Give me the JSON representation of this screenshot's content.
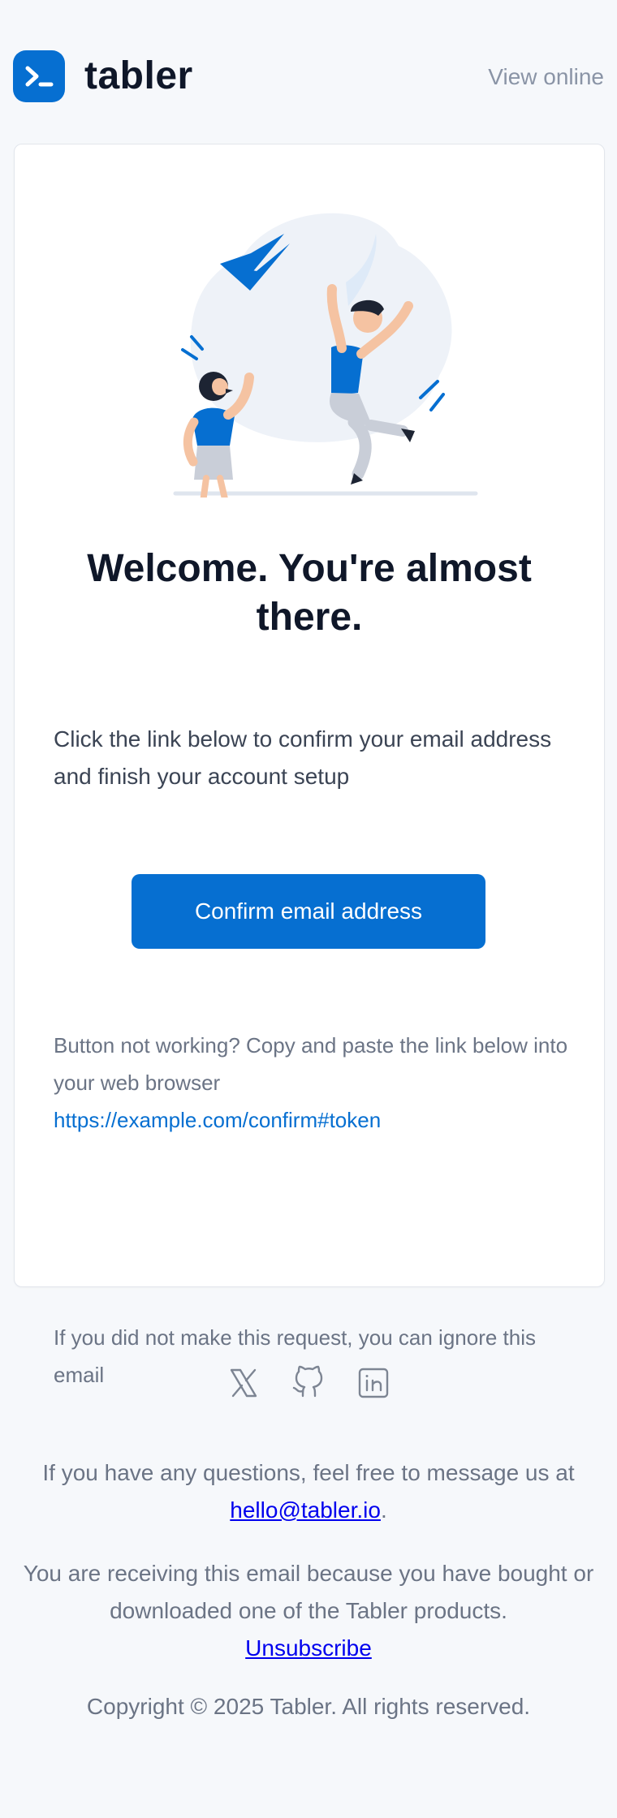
{
  "header": {
    "brand_name": "tabler",
    "view_online": "View online",
    "logo_icon": "terminal-prompt-icon"
  },
  "card": {
    "illustration_icon": "celebrating-people-illustration",
    "title": "Welcome. You're almost there.",
    "intro": "Click the link below to confirm your email address and finish your account setup",
    "confirm_button": "Confirm email address",
    "fallback_text": "Button not working? Copy and paste the link below into your web browser",
    "fallback_link": "https://example.com/confirm#token",
    "ignore_text": "If you did not make this request, you can ignore this email"
  },
  "footer": {
    "social": [
      {
        "name": "x-icon"
      },
      {
        "name": "github-icon"
      },
      {
        "name": "linkedin-icon"
      }
    ],
    "questions_text": "If you have any questions, feel free to message us at",
    "email": "hello@tabler.io",
    "period": ".",
    "receiving_text": "You are receiving this email because you have bought or downloaded one of the Tabler products.",
    "unsubscribe": "Unsubscribe",
    "copyright": "Copyright © 2025 Tabler. All rights reserved."
  },
  "colors": {
    "accent": "#066fd1",
    "background": "#f6f8fb",
    "heading": "#0f1729",
    "muted": "#6b7485"
  }
}
